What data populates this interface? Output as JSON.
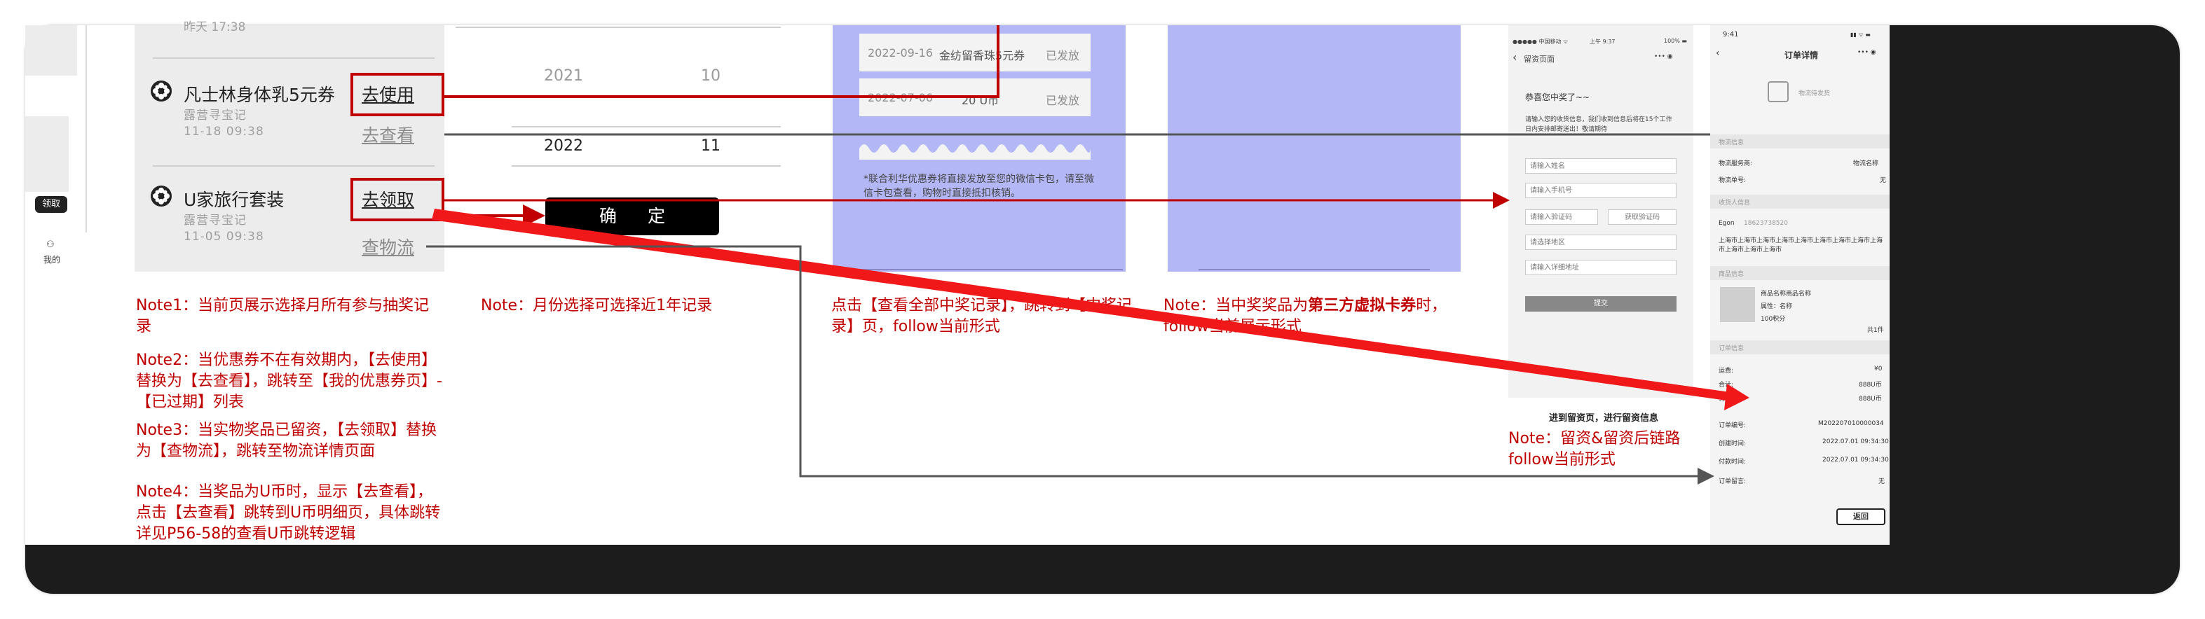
{
  "colors": {
    "accent_red": "#c00000",
    "arrow_grey": "#555555",
    "panel_blue": "#b3b7f5",
    "dark": "#1c1c1c"
  },
  "left_panel": {
    "top_text": "昨天 17:38",
    "claim_pill": "领取",
    "nav_label": "我的",
    "nav_icon": "person-icon"
  },
  "prize_list": {
    "items": [
      {
        "title": "凡士林身体乳5元券",
        "source": "露营寻宝记",
        "time": "11-18 09:38",
        "primary_action": "去使用",
        "secondary_action": "去查看"
      },
      {
        "title": "U家旅行套装",
        "source": "露营寻宝记",
        "time": "11-05 09:38",
        "primary_action": "去领取",
        "secondary_action": "查物流"
      }
    ],
    "icon": "flower-icon"
  },
  "picker": {
    "rows": [
      {
        "year": "2021",
        "month": "10"
      },
      {
        "year": "2022",
        "month": "11"
      }
    ],
    "confirm_label": "确  定"
  },
  "records": {
    "rows": [
      {
        "date": "2022-09-16",
        "name": "金纺留香珠5元券",
        "status": "已发放"
      },
      {
        "date": "2022-07-06",
        "name": "20 U币",
        "status": "已发放"
      }
    ],
    "footnote": "*联合利华优惠券将直接发放至您的微信卡包，请至微信卡包查看，购物时直接抵扣核销。"
  },
  "phone_form": {
    "status_left": "●●●●● 中国移动 ᯤ",
    "status_center": "上午 9:37",
    "status_right": "100% ▬",
    "back": "‹",
    "title": "留资页面",
    "menu": "••• ◉",
    "heading": "恭喜您中奖了~~",
    "desc": "请输入您的收货信息，我们收到信息后将在15个工作日内安排邮寄送出！敬请期待",
    "fields": [
      "请输入姓名",
      "请输入手机号",
      "请输入验证码",
      "请选择地区",
      "请输入详细地址"
    ],
    "get_code": "获取验证码",
    "submit": "提交",
    "caption": "进到留资页，进行留资信息"
  },
  "order_detail": {
    "status_time": "9:41",
    "status_icons": "▮▮ ᯤ ▬",
    "back": "‹",
    "title": "订单详情",
    "menu": "••• ◉",
    "logistics_empty": "物流待发货",
    "sections": {
      "logistics": "物流信息",
      "receiver": "收货人信息",
      "goods": "商品信息",
      "order": "订单信息"
    },
    "logistics_rows": [
      {
        "label": "物流服务商:",
        "value": "物流名称"
      },
      {
        "label": "物流单号:",
        "value": "无"
      }
    ],
    "receiver_name": "Egon",
    "receiver_phone": "18623738520",
    "receiver_address": "上海市上海市上海市上海市上海市上海市上海市上海市上海市上海市上海市上海市",
    "goods": {
      "name": "商品名称商品名称",
      "attr": "属性：名称",
      "points": "100积分",
      "qty": "共1件"
    },
    "fee_rows": [
      {
        "label": "运费:",
        "value": "¥0"
      },
      {
        "label": "合计:",
        "value": "888U币"
      },
      {
        "label": "实付:",
        "value": "888U币"
      }
    ],
    "order_rows": [
      {
        "label": "订单编号:",
        "value": "M202207010000034"
      },
      {
        "label": "创建时间:",
        "value": "2022.07.01 09:34:30"
      },
      {
        "label": "付款时间:",
        "value": "2022.07.01 09:34:30"
      },
      {
        "label": "订单留言:",
        "value": "无"
      }
    ],
    "return_button": "返回"
  },
  "notes": {
    "note1": "Note1：当前页展示选择月所有参与抽奖记录",
    "note2": "Note2：当优惠券不在有效期内，【去使用】替换为【去查看】，跳转至【我的优惠券页】-【已过期】列表",
    "note3": "Note3：当实物奖品已留资，【去领取】替换为【查物流】，跳转至物流详情页面",
    "note4": "Note4：当奖品为U币时，显示【去查看】，点击【去查看】跳转到U币明细页，具体跳转详见P56-58的查看U币跳转逻辑",
    "picker_note": "Note：月份选择可选择近1年记录",
    "records_note": "点击【查看全部中奖记录】，跳转到【中奖记录】页，follow当前形式",
    "virtual_note_prefix": "Note：当中奖奖品为",
    "virtual_note_bold": "第三方虚拟卡券",
    "virtual_note_suffix": "时，follow当前展示形式",
    "form_note": "Note：留资&留资后链路follow当前形式"
  }
}
